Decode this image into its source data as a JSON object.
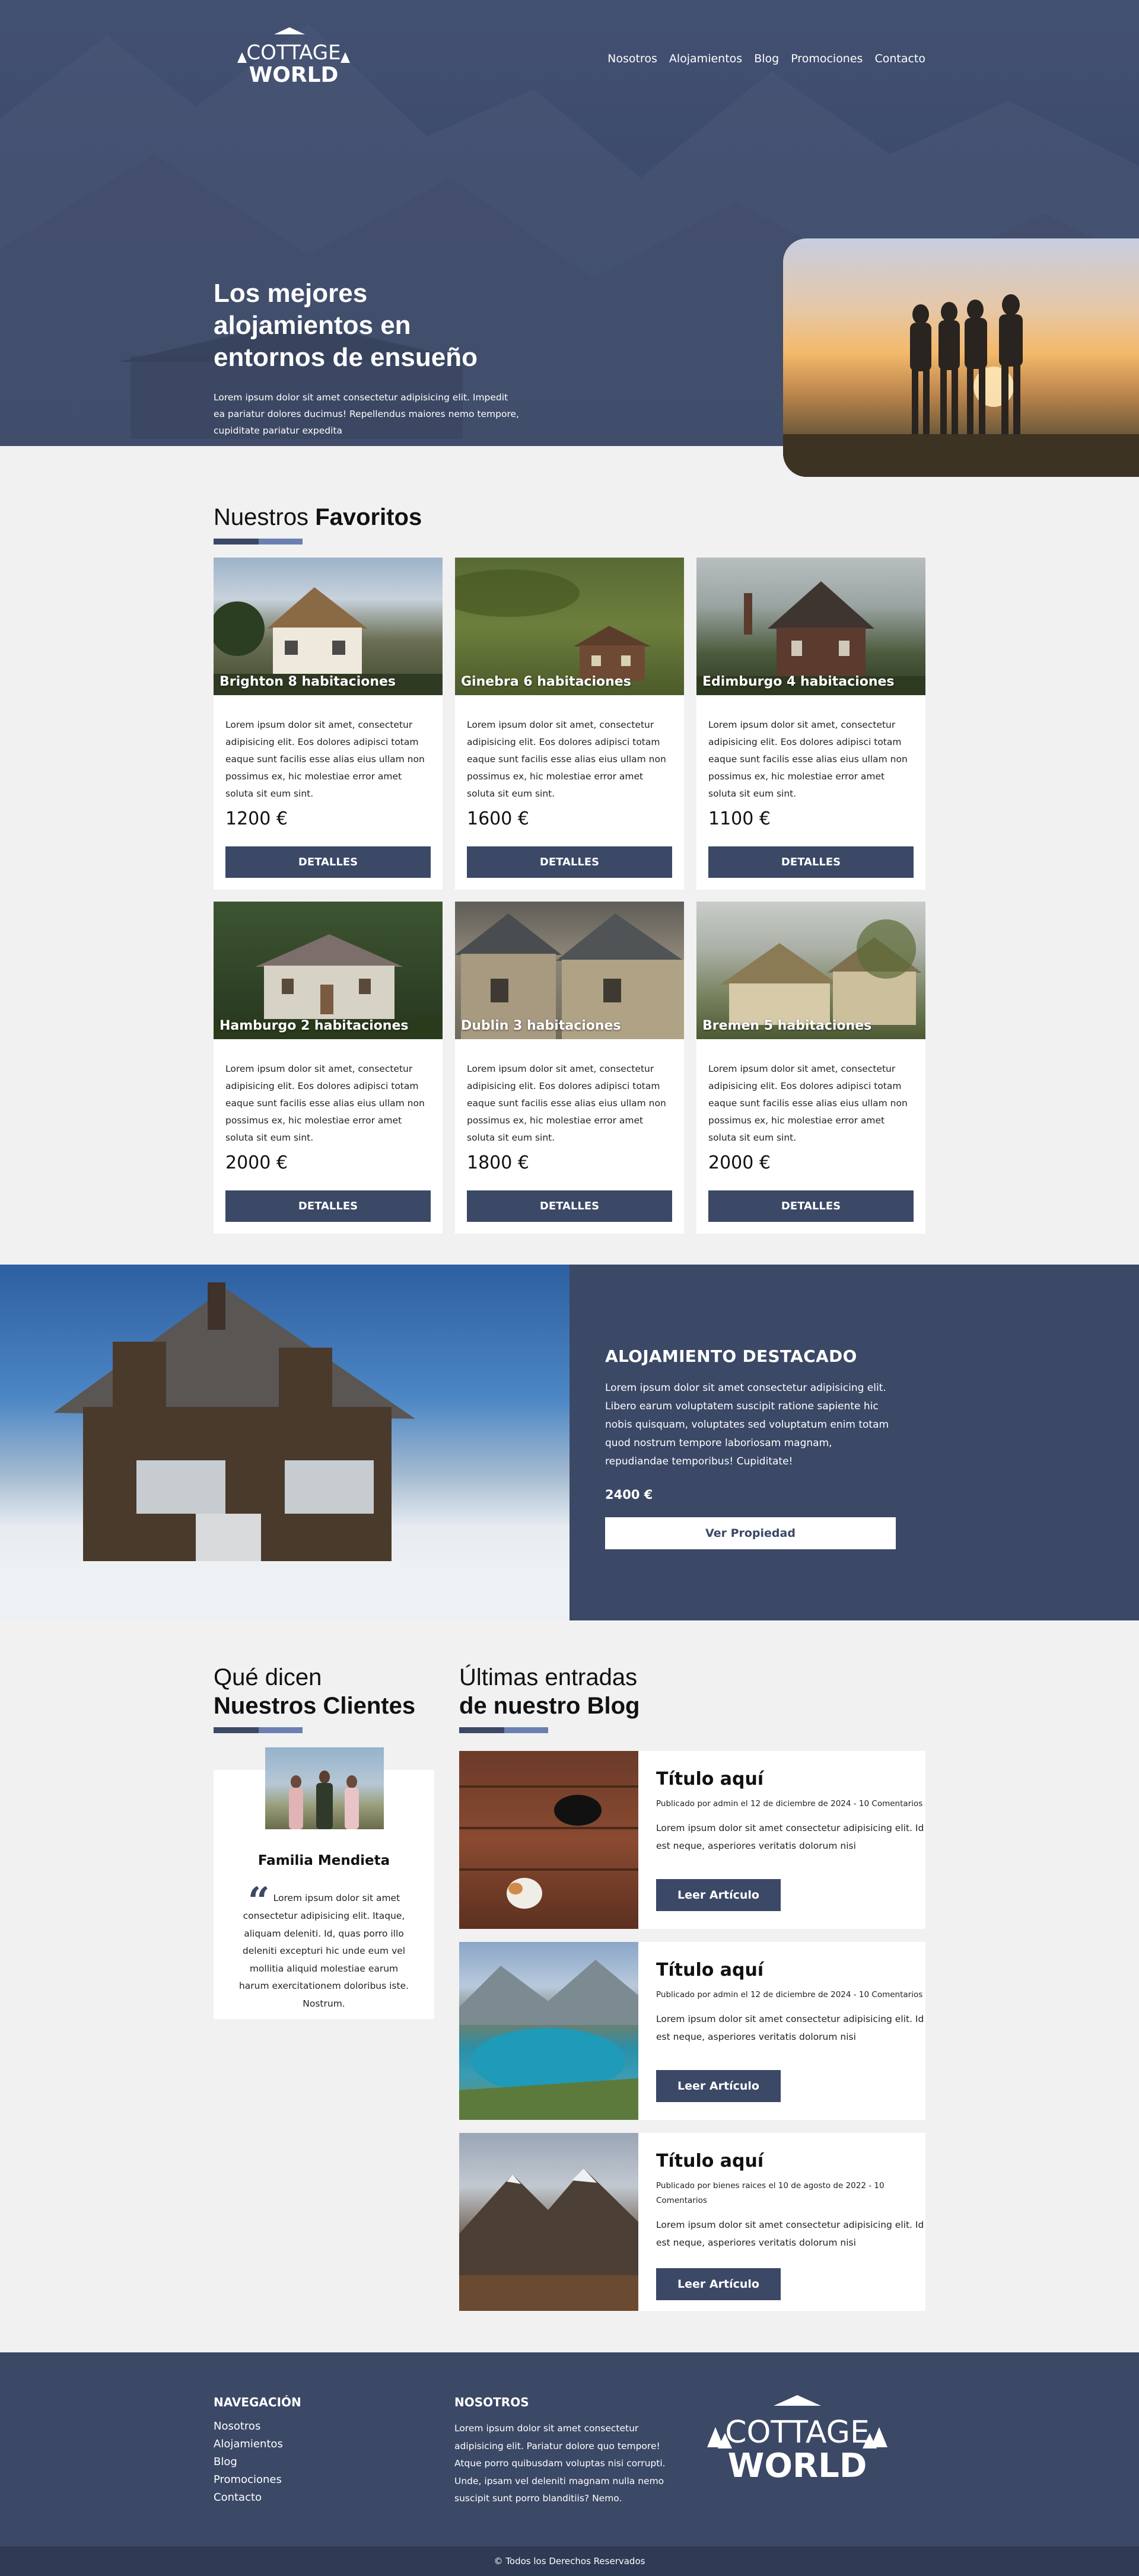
{
  "brand": {
    "logo_top": "COTTAGE",
    "logo_bottom": "WORLD"
  },
  "nav": [
    "Nosotros",
    "Alojamientos",
    "Blog",
    "Promociones",
    "Contacto"
  ],
  "hero": {
    "title": "Los mejores alojamientos en entornos de ensueño",
    "subtitle": "Lorem ipsum dolor sit amet consectetur adipisicing elit. Impedit ea pariatur dolores ducimus! Repellendus maiores nemo tempore, cupiditate pariatur expedita"
  },
  "favoritos": {
    "title_light": "Nuestros",
    "title_bold": "Favoritos",
    "cards": [
      {
        "name": "Brighton 8 habitaciones",
        "desc": "Lorem ipsum dolor sit amet, consectetur adipisicing elit. Eos dolores adipisci totam eaque sunt facilis esse alias eius ullam non possimus ex, hic molestiae error amet soluta sit eum sint.",
        "price": "1200 €",
        "button": "DETALLES"
      },
      {
        "name": "Ginebra 6 habitaciones",
        "desc": "Lorem ipsum dolor sit amet, consectetur adipisicing elit. Eos dolores adipisci totam eaque sunt facilis esse alias eius ullam non possimus ex, hic molestiae error amet soluta sit eum sint.",
        "price": "1600 €",
        "button": "DETALLES"
      },
      {
        "name": "Edimburgo 4 habitaciones",
        "desc": "Lorem ipsum dolor sit amet, consectetur adipisicing elit. Eos dolores adipisci totam eaque sunt facilis esse alias eius ullam non possimus ex, hic molestiae error amet soluta sit eum sint.",
        "price": "1100 €",
        "button": "DETALLES"
      },
      {
        "name": "Hamburgo 2 habitaciones",
        "desc": "Lorem ipsum dolor sit amet, consectetur adipisicing elit. Eos dolores adipisci totam eaque sunt facilis esse alias eius ullam non possimus ex, hic molestiae error amet soluta sit eum sint.",
        "price": "2000 €",
        "button": "DETALLES"
      },
      {
        "name": "Dublin 3 habitaciones",
        "desc": "Lorem ipsum dolor sit amet, consectetur adipisicing elit. Eos dolores adipisci totam eaque sunt facilis esse alias eius ullam non possimus ex, hic molestiae error amet soluta sit eum sint.",
        "price": "1800 €",
        "button": "DETALLES"
      },
      {
        "name": "Bremen 5 habitaciones",
        "desc": "Lorem ipsum dolor sit amet, consectetur adipisicing elit. Eos dolores adipisci totam eaque sunt facilis esse alias eius ullam non possimus ex, hic molestiae error amet soluta sit eum sint.",
        "price": "2000 €",
        "button": "DETALLES"
      }
    ]
  },
  "destacado": {
    "title": "ALOJAMIENTO DESTACADO",
    "desc": "Lorem ipsum dolor sit amet consectetur adipisicing elit. Libero earum voluptatem suscipit ratione sapiente hic nobis quisquam, voluptates sed voluptatum enim totam quod nostrum tempore laboriosam magnam, repudiandae temporibus! Cupiditate!",
    "price": "2400 €",
    "button": "Ver Propiedad"
  },
  "testimonios": {
    "title_light": "Qué dicen",
    "title_bold": "Nuestros Clientes",
    "name": "Familia Mendieta",
    "quote_mark": "“",
    "text": "Lorem ipsum dolor sit amet consectetur adipisicing elit. Itaque, aliquam deleniti. Id, quas porro illo deleniti excepturi hic unde eum vel mollitia aliquid molestiae earum harum exercitationem doloribus iste. Nostrum."
  },
  "blog": {
    "title_light": "Últimas entradas",
    "title_bold": "de nuestro Blog",
    "posts": [
      {
        "title": "Título aquí",
        "meta": "Publicado por admin el 12 de diciembre de 2024 - 10 Comentarios",
        "excerpt": "Lorem ipsum dolor sit amet consectetur adipisicing elit. Id est neque, asperiores veritatis dolorum nisi",
        "button": "Leer Artículo"
      },
      {
        "title": "Título aquí",
        "meta": "Publicado por admin el 12 de diciembre de 2024 - 10 Comentarios",
        "excerpt": "Lorem ipsum dolor sit amet consectetur adipisicing elit. Id est neque, asperiores veritatis dolorum nisi",
        "button": "Leer Artículo"
      },
      {
        "title": "Título aquí",
        "meta": "Publicado por bienes raices el 10 de agosto de 2022 - 10 Comentarios",
        "excerpt": "Lorem ipsum dolor sit amet consectetur adipisicing elit. Id est neque, asperiores veritatis dolorum nisi",
        "button": "Leer Artículo"
      }
    ]
  },
  "footer": {
    "nav_title": "NAVEGACIÓN",
    "nav": [
      "Nosotros",
      "Alojamientos",
      "Blog",
      "Promociones",
      "Contacto"
    ],
    "about_title": "NOSOTROS",
    "about": "Lorem ipsum dolor sit amet consectetur adipisicing elit. Pariatur dolore quo tempore! Atque porro quibusdam voluptas nisi corrupti. Unde, ipsam vel deleniti magnam nulla nemo suscipit sunt porro blanditiis? Nemo.",
    "copyright": "© Todos los Derechos Reservados"
  },
  "colors": {
    "primary": "#3b4866",
    "accent": "#6b7fb0",
    "background": "#f1f1f1",
    "footer_bottom": "#2f3a54"
  }
}
